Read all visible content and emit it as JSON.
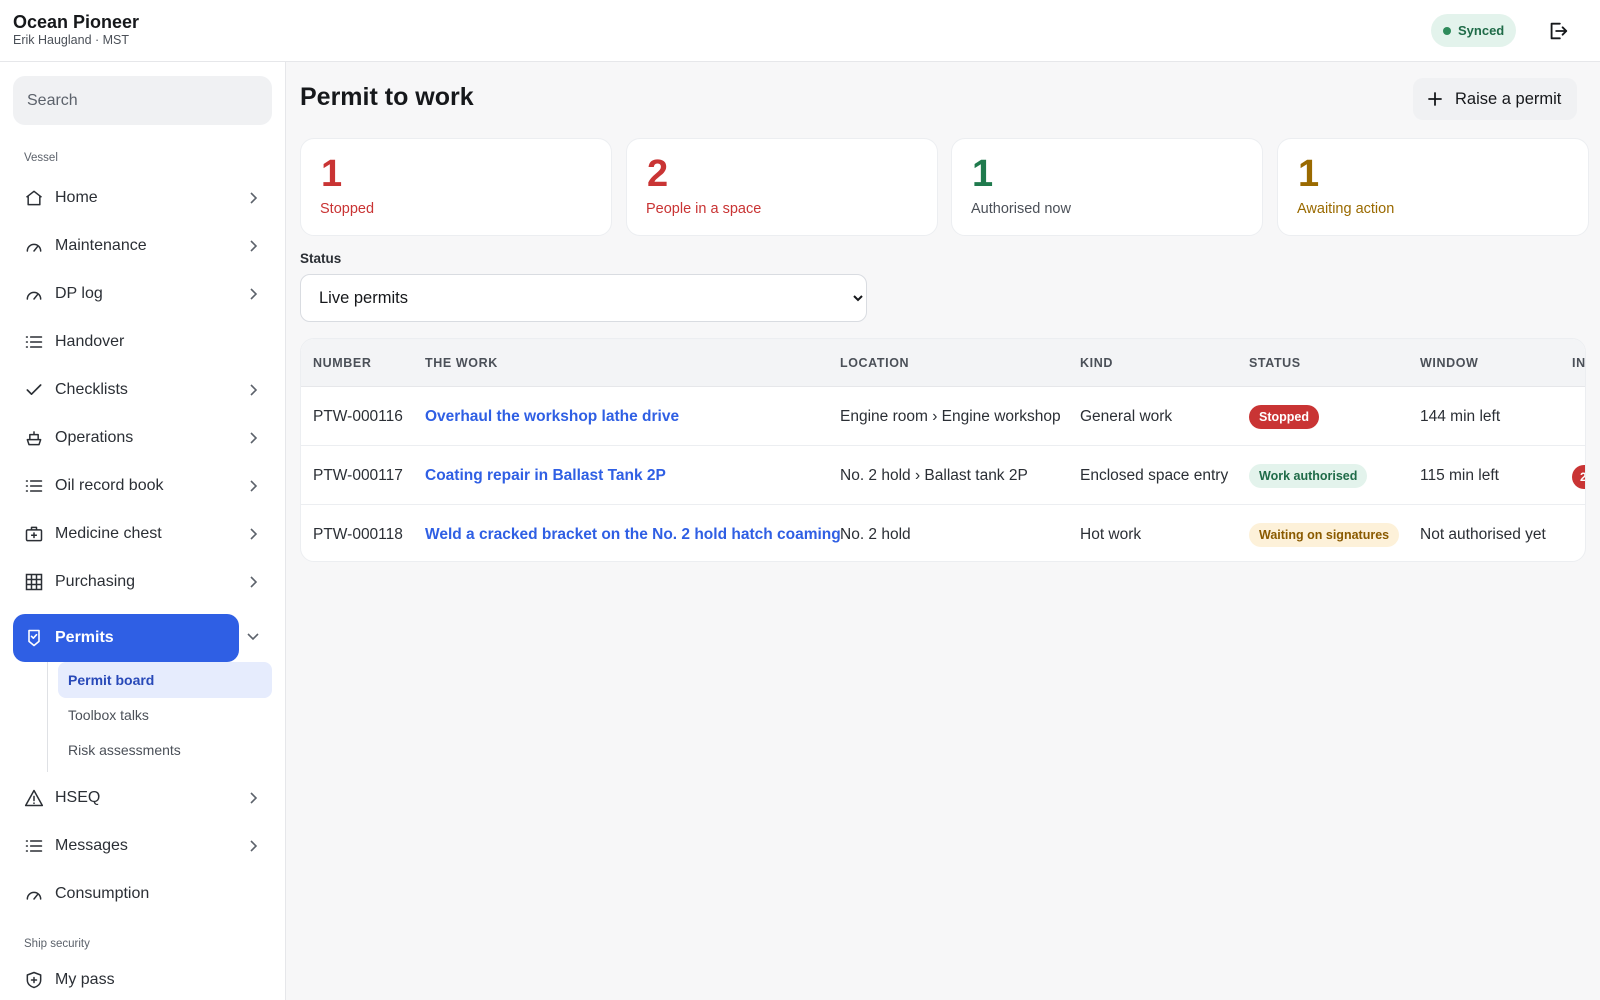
{
  "header": {
    "vessel_name": "Ocean Pioneer",
    "user_line": "Erik Haugland · MST",
    "sync_status": "Synced"
  },
  "sidebar": {
    "search_placeholder": "Search",
    "section_vessel": "Vessel",
    "items": [
      {
        "label": "Home",
        "icon": "home-icon"
      },
      {
        "label": "Maintenance",
        "icon": "gauge-icon"
      },
      {
        "label": "DP log",
        "icon": "gauge-icon"
      },
      {
        "label": "Handover",
        "icon": "list-icon"
      },
      {
        "label": "Checklists",
        "icon": "check-icon"
      },
      {
        "label": "Operations",
        "icon": "ship-icon"
      },
      {
        "label": "Oil record book",
        "icon": "list-icon"
      },
      {
        "label": "Medicine chest",
        "icon": "medical-kit-icon"
      },
      {
        "label": "Purchasing",
        "icon": "grid-icon"
      },
      {
        "label": "Permits",
        "icon": "permit-shield-icon"
      },
      {
        "label": "HSEQ",
        "icon": "warning-icon"
      },
      {
        "label": "Messages",
        "icon": "list-icon"
      },
      {
        "label": "Consumption",
        "icon": "gauge-icon"
      }
    ],
    "permits_sub": [
      {
        "label": "Permit board"
      },
      {
        "label": "Toolbox talks"
      },
      {
        "label": "Risk assessments"
      }
    ],
    "section_security": "Ship security",
    "security_items": [
      {
        "label": "My pass",
        "icon": "shield-plus-icon"
      }
    ]
  },
  "main": {
    "title": "Permit to work",
    "raise_label": "Raise a permit",
    "stats": [
      {
        "value": "1",
        "label": "Stopped",
        "color": "#c93434"
      },
      {
        "value": "2",
        "label": "People in a space",
        "color": "#c93434"
      },
      {
        "value": "1",
        "label": "Authorised now",
        "color": "#1f7a4d"
      },
      {
        "value": "1",
        "label": "Awaiting action",
        "color": "#9a6a00"
      }
    ],
    "filter": {
      "label": "Status",
      "value": "Live permits"
    },
    "table": {
      "headers": [
        "NUMBER",
        "THE WORK",
        "LOCATION",
        "KIND",
        "STATUS",
        "WINDOW",
        "IN"
      ],
      "rows": [
        {
          "number": "PTW-000116",
          "work": "Overhaul the workshop lathe drive",
          "location": "Engine room › Engine workshop",
          "kind": "General work",
          "status": "Stopped",
          "window": "144 min left",
          "in": ""
        },
        {
          "number": "PTW-000117",
          "work": "Coating repair in Ballast Tank 2P",
          "location": "No. 2 hold › Ballast tank 2P",
          "kind": "Enclosed space entry",
          "status": "Work authorised",
          "window": "115 min left",
          "in": "2"
        },
        {
          "number": "PTW-000118",
          "work": "Weld a cracked bracket on the No. 2 hold hatch coaming",
          "location": "No. 2 hold",
          "kind": "Hot work",
          "status": "Waiting on signatures",
          "window": "Not authorised yet",
          "in": ""
        }
      ]
    }
  }
}
